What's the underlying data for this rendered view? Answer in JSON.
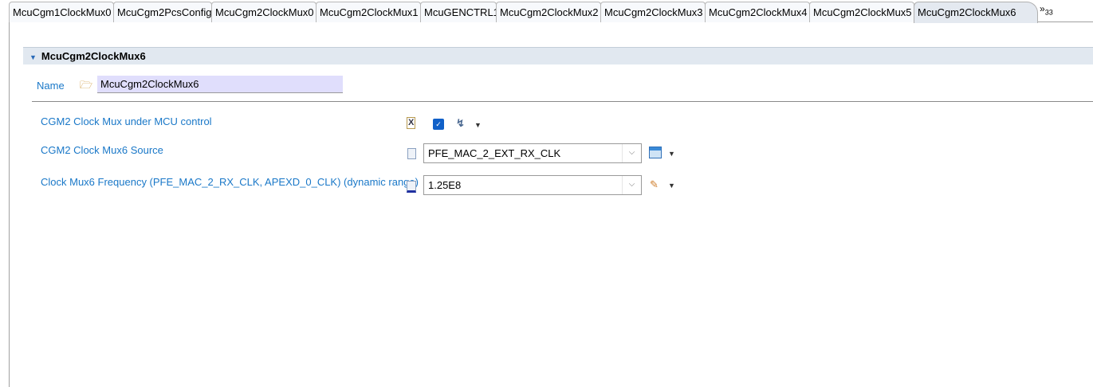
{
  "tabs": [
    "McuCgm1ClockMux0",
    "McuCgm2PcsConfig",
    "McuCgm2ClockMux0",
    "McuCgm2ClockMux1",
    "McuGENCTRL1",
    "McuCgm2ClockMux2",
    "McuCgm2ClockMux3",
    "McuCgm2ClockMux4",
    "McuCgm2ClockMux5",
    "McuCgm2ClockMux6"
  ],
  "overflow": {
    "chevron": "»",
    "count": "33"
  },
  "section": {
    "title": "McuCgm2ClockMux6"
  },
  "name": {
    "label": "Name",
    "value": "McuCgm2ClockMux6"
  },
  "fields": [
    {
      "label": "CGM2 Clock Mux under MCU control",
      "checked": true
    },
    {
      "label": "CGM2 Clock Mux6 Source",
      "value": "PFE_MAC_2_EXT_RX_CLK"
    },
    {
      "label": "Clock Mux6 Frequency (PFE_MAC_2_RX_CLK, APEXD_0_CLK) (dynamic range)",
      "value": "1.25E8"
    }
  ],
  "icons": {
    "check": "✓",
    "tri": "▼",
    "arrow": "⌵"
  }
}
